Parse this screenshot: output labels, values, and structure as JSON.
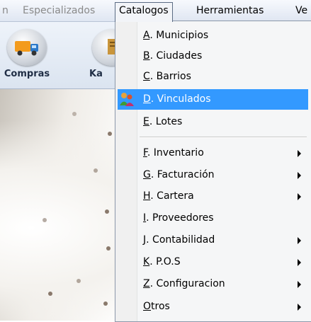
{
  "menubar": {
    "items": [
      {
        "label": "n"
      },
      {
        "label": "Especializados"
      },
      {
        "label": "Catalogos"
      },
      {
        "label": "Herramientas"
      },
      {
        "label": "Ve"
      }
    ]
  },
  "toolbar": {
    "buttons": [
      {
        "label": "Compras",
        "icon": "truck-icon"
      },
      {
        "label": "Ka",
        "icon": "kardex-icon"
      }
    ]
  },
  "menu": {
    "items": [
      {
        "key": "A",
        "label": ". Municipios",
        "has_submenu": false
      },
      {
        "key": "B",
        "label": ". Ciudades",
        "has_submenu": false
      },
      {
        "key": "C",
        "label": ". Barrios",
        "has_submenu": false
      },
      {
        "key": "D",
        "label": ". Vinculados",
        "has_submenu": false,
        "highlighted": true,
        "icon": "people-icon"
      },
      {
        "key": "E",
        "label": ". Lotes",
        "has_submenu": false
      },
      {
        "key": "F",
        "label": ".  Inventario",
        "has_submenu": true
      },
      {
        "key": "G",
        "label": ". Facturación",
        "has_submenu": true
      },
      {
        "key": "H",
        "label": ". Cartera",
        "has_submenu": true
      },
      {
        "key": "I",
        "label": ".  Proveedores",
        "has_submenu": false
      },
      {
        "key": "J",
        "label": ". Contabilidad",
        "has_submenu": true
      },
      {
        "key": "K",
        "label": ". P.O.S",
        "has_submenu": true
      },
      {
        "key": "Z",
        "label": ". Configuracion",
        "has_submenu": true
      },
      {
        "key": "O",
        "label": "tros",
        "has_submenu": true
      }
    ],
    "highlight_color": "#3399ff"
  }
}
